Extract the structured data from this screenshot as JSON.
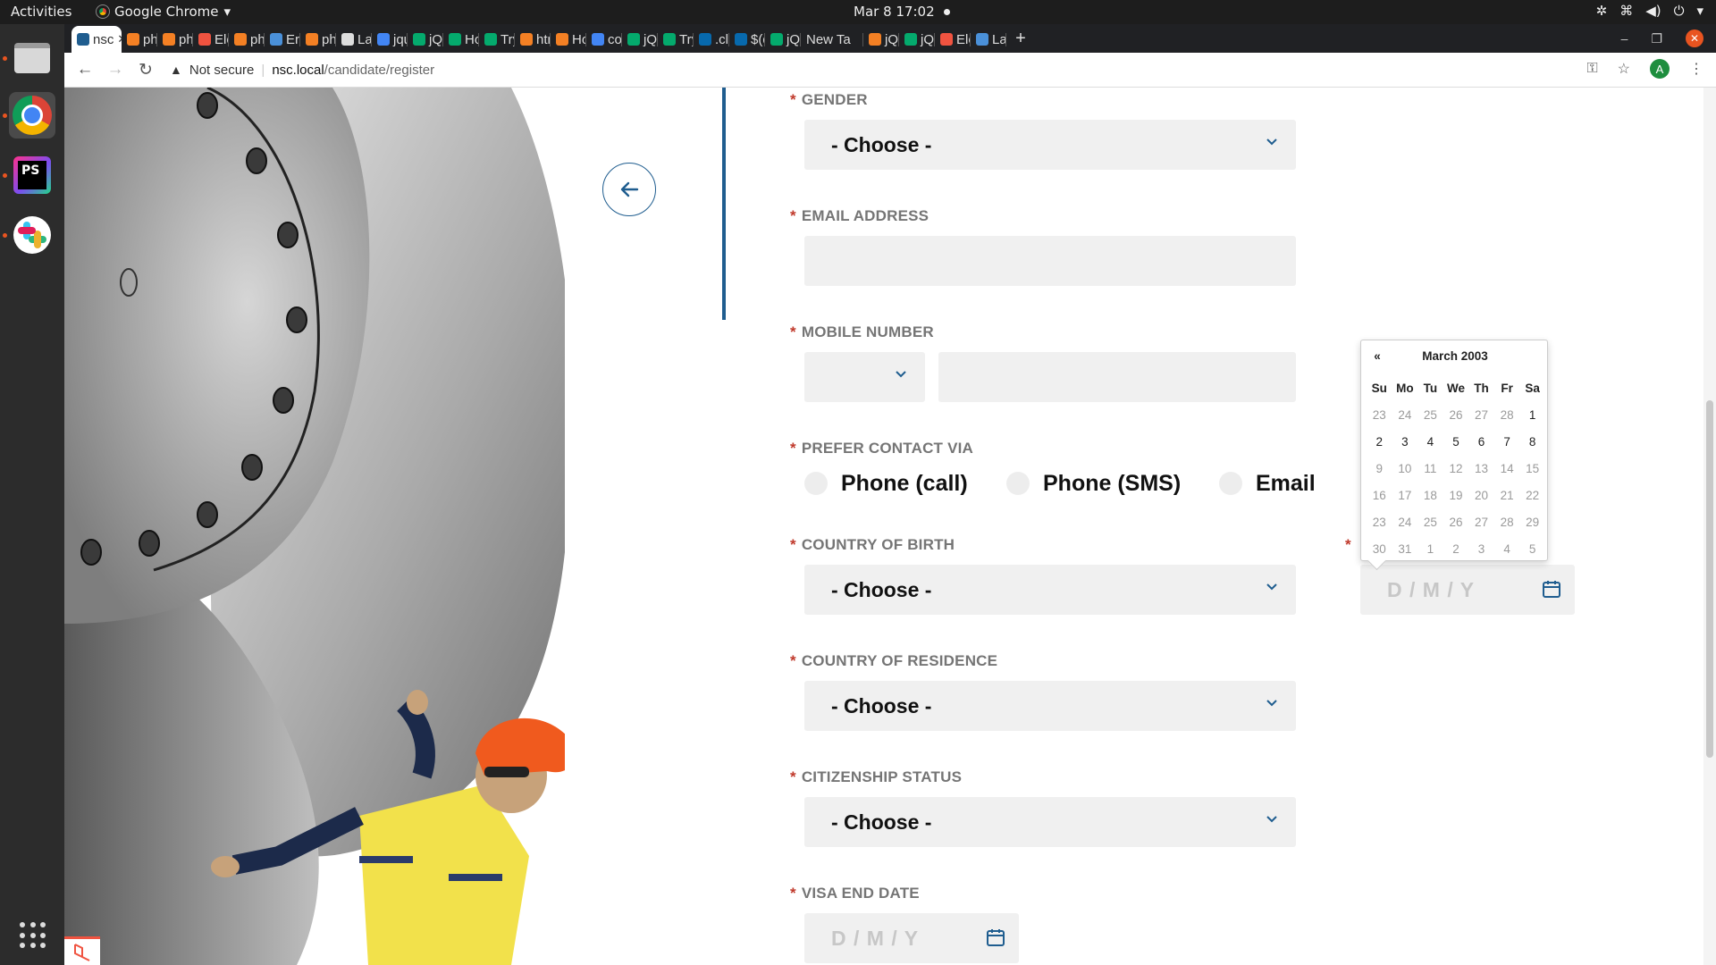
{
  "topbar": {
    "activities": "Activities",
    "app_menu": "Google Chrome",
    "clock": "Mar 8  17:02"
  },
  "browser": {
    "tabs": [
      {
        "label": "nsc",
        "fav": "#1f5d8f"
      },
      {
        "label": "php",
        "fav": "#f48024"
      },
      {
        "label": "php",
        "fav": "#f48024"
      },
      {
        "label": "Eloc",
        "fav": "#f05340"
      },
      {
        "label": "php",
        "fav": "#f48024"
      },
      {
        "label": "Erro",
        "fav": "#4a90d9"
      },
      {
        "label": "php",
        "fav": "#f48024"
      },
      {
        "label": "Lara",
        "fav": "#dddddd"
      },
      {
        "label": "jque",
        "fav": "#4285f4"
      },
      {
        "label": "jQu",
        "fav": "#04aa6d"
      },
      {
        "label": "How",
        "fav": "#04aa6d"
      },
      {
        "label": "Tryi",
        "fav": "#04aa6d"
      },
      {
        "label": "htm",
        "fav": "#f48024"
      },
      {
        "label": "How",
        "fav": "#f48024"
      },
      {
        "label": "colo",
        "fav": "#4285f4"
      },
      {
        "label": "jQu",
        "fav": "#04aa6d"
      },
      {
        "label": "Tryi",
        "fav": "#04aa6d"
      },
      {
        "label": ".clic",
        "fav": "#0769ad"
      },
      {
        "label": "$(d",
        "fav": "#0769ad"
      },
      {
        "label": "jQu",
        "fav": "#04aa6d"
      },
      {
        "label": "New Ta",
        "fav": ""
      },
      {
        "label": "jQu",
        "fav": "#f48024"
      },
      {
        "label": "jQu",
        "fav": "#04aa6d"
      },
      {
        "label": "Elo",
        "fav": "#f05340"
      },
      {
        "label": "Lar",
        "fav": "#4a90d9"
      }
    ],
    "security_label": "Not secure",
    "url_host": "nsc.local",
    "url_path": "/candidate/register",
    "profile_initial": "A"
  },
  "form": {
    "gender": {
      "label": "GENDER",
      "value": "- Choose -"
    },
    "email": {
      "label": "EMAIL ADDRESS",
      "value": ""
    },
    "mobile": {
      "label": "MOBILE NUMBER",
      "code": "",
      "value": ""
    },
    "contact": {
      "label": "PREFER CONTACT VIA",
      "options": [
        "Phone (call)",
        "Phone (SMS)",
        "Email"
      ]
    },
    "country_birth": {
      "label": "COUNTRY OF BIRTH",
      "value": "- Choose -"
    },
    "dob": {
      "placeholder": "D / M / Y"
    },
    "country_residence": {
      "label": "COUNTRY OF RESIDENCE",
      "value": "- Choose -"
    },
    "citizenship": {
      "label": "CITIZENSHIP STATUS",
      "value": "- Choose -"
    },
    "visa_end": {
      "label": "VISA END DATE",
      "placeholder": "D / M / Y"
    },
    "required_mark": "*"
  },
  "datepicker": {
    "prev": "«",
    "title": "March 2003",
    "weekdays": [
      "Su",
      "Mo",
      "Tu",
      "We",
      "Th",
      "Fr",
      "Sa"
    ],
    "weeks": [
      [
        {
          "d": "23",
          "m": 1
        },
        {
          "d": "24",
          "m": 1
        },
        {
          "d": "25",
          "m": 1
        },
        {
          "d": "26",
          "m": 1
        },
        {
          "d": "27",
          "m": 1
        },
        {
          "d": "28",
          "m": 1
        },
        {
          "d": "1",
          "m": 0
        }
      ],
      [
        {
          "d": "2",
          "m": 0
        },
        {
          "d": "3",
          "m": 0
        },
        {
          "d": "4",
          "m": 0
        },
        {
          "d": "5",
          "m": 0
        },
        {
          "d": "6",
          "m": 0
        },
        {
          "d": "7",
          "m": 0
        },
        {
          "d": "8",
          "m": 0
        }
      ],
      [
        {
          "d": "9",
          "m": 2
        },
        {
          "d": "10",
          "m": 2
        },
        {
          "d": "11",
          "m": 2
        },
        {
          "d": "12",
          "m": 2
        },
        {
          "d": "13",
          "m": 2
        },
        {
          "d": "14",
          "m": 2
        },
        {
          "d": "15",
          "m": 2
        }
      ],
      [
        {
          "d": "16",
          "m": 2
        },
        {
          "d": "17",
          "m": 2
        },
        {
          "d": "18",
          "m": 2
        },
        {
          "d": "19",
          "m": 2
        },
        {
          "d": "20",
          "m": 2
        },
        {
          "d": "21",
          "m": 2
        },
        {
          "d": "22",
          "m": 2
        }
      ],
      [
        {
          "d": "23",
          "m": 2
        },
        {
          "d": "24",
          "m": 2
        },
        {
          "d": "25",
          "m": 2
        },
        {
          "d": "26",
          "m": 2
        },
        {
          "d": "27",
          "m": 2
        },
        {
          "d": "28",
          "m": 2
        },
        {
          "d": "29",
          "m": 2
        }
      ],
      [
        {
          "d": "30",
          "m": 2
        },
        {
          "d": "31",
          "m": 2
        },
        {
          "d": "1",
          "m": 1
        },
        {
          "d": "2",
          "m": 1
        },
        {
          "d": "3",
          "m": 1
        },
        {
          "d": "4",
          "m": 1
        },
        {
          "d": "5",
          "m": 1
        }
      ]
    ]
  },
  "colors": {
    "accent": "#1f5d8f",
    "required": "#c0392b",
    "field_bg": "#f0f0f0"
  }
}
